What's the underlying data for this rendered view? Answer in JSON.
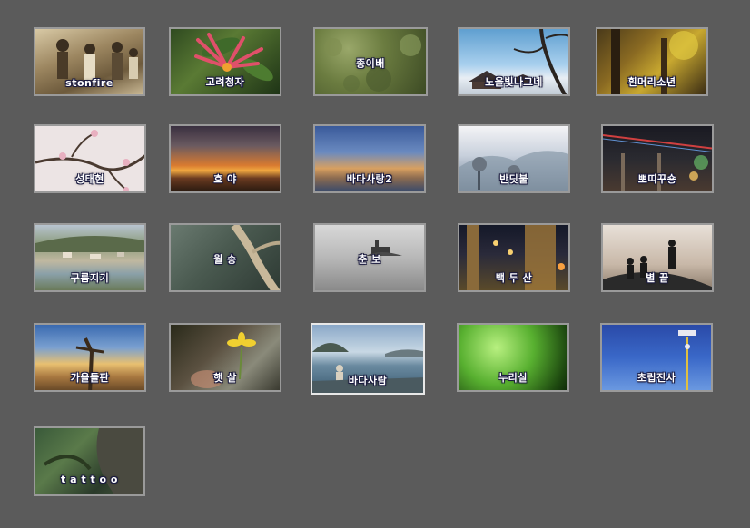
{
  "gallery": {
    "items": [
      {
        "label": "stonfire"
      },
      {
        "label": "고려청자"
      },
      {
        "label": "종이배"
      },
      {
        "label": "노을빛나그네"
      },
      {
        "label": "흰머리소년"
      },
      {
        "label": "성태현"
      },
      {
        "label": "호  야"
      },
      {
        "label": "바다사랑2"
      },
      {
        "label": "반딧불"
      },
      {
        "label": "뽀띠꾸숑"
      },
      {
        "label": "구름지기"
      },
      {
        "label": "월  송"
      },
      {
        "label": "춘  보"
      },
      {
        "label": "백 두 산"
      },
      {
        "label": "별  끝"
      },
      {
        "label": "가을들판"
      },
      {
        "label": "햇  살"
      },
      {
        "label": "바다사람"
      },
      {
        "label": "누리실"
      },
      {
        "label": "초립진사"
      },
      {
        "label": "t a t t o o"
      }
    ]
  }
}
